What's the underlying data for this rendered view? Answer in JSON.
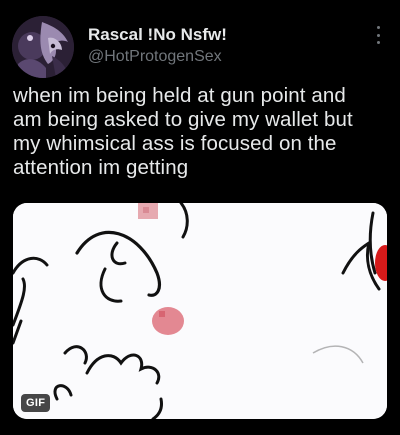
{
  "author": {
    "display_name": "Rascal !No Nsfw!",
    "handle": "@HotProtogenSex",
    "avatar_icon": "character-avatar-icon"
  },
  "tweet": {
    "text": "when im being held at gun point and\nam being asked to give my wallet but\nmy whimsical ass is focused on the\nattention im getting"
  },
  "media": {
    "type_badge": "GIF"
  },
  "colors": {
    "background": "#000000",
    "primary_text": "#e7e9ea",
    "secondary_text": "#71767b",
    "cheek_pink": "#e07b86",
    "accent_red": "#d61a1a"
  }
}
